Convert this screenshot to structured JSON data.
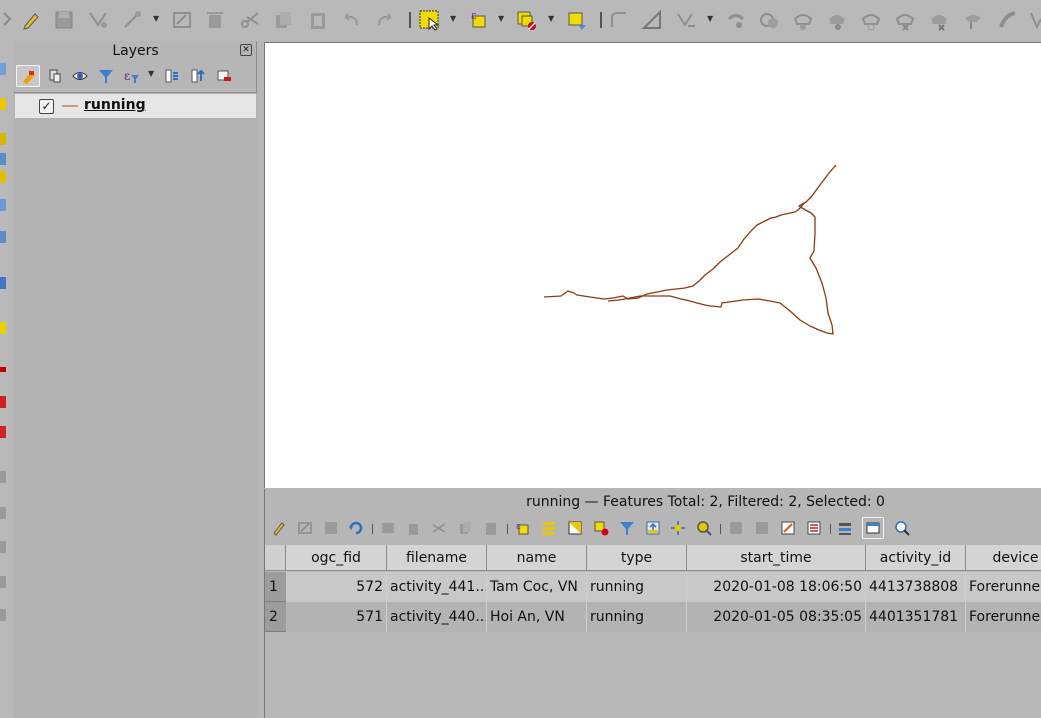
{
  "layers_panel": {
    "title": "Layers",
    "close": "✕",
    "layer": {
      "name": "running",
      "checked": "✓"
    }
  },
  "attribute_table": {
    "title": "running — Features Total: 2, Filtered: 2, Selected: 0",
    "columns": [
      "ogc_fid",
      "filename",
      "name",
      "type",
      "start_time",
      "activity_id",
      "device"
    ],
    "rows": [
      {
        "num": "1",
        "ogc_fid": "572",
        "filename": "activity_441...",
        "name": "Tam Coc, VN",
        "type": "running",
        "start_time": "2020-01-08 18:06:50",
        "activity_id": "4413738808",
        "device": "Forerunner"
      },
      {
        "num": "2",
        "ogc_fid": "571",
        "filename": "activity_440...",
        "name": "Hoi An, VN",
        "type": "running",
        "start_time": "2020-01-05 08:35:05",
        "activity_id": "4401351781",
        "device": "Forerunner"
      }
    ]
  },
  "colors": {
    "track": "#8b3a12",
    "layer_symbol": "#c79b84",
    "highlight": "#f0dc00"
  }
}
